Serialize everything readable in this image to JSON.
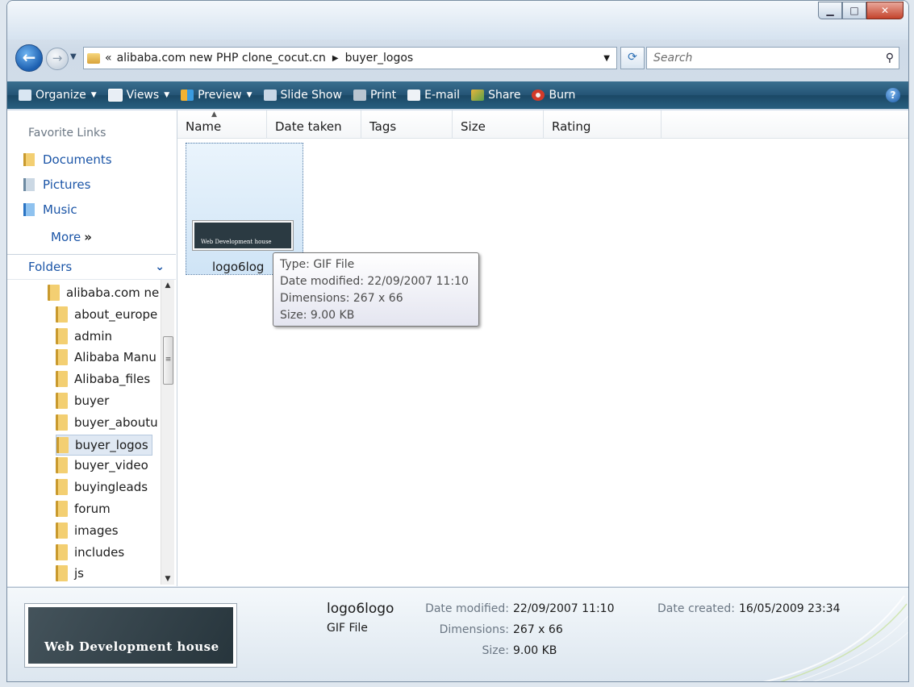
{
  "address": {
    "chevrons": "«",
    "crumbs": [
      "alibaba.com new PHP clone_cocut.cn",
      "buyer_logos"
    ]
  },
  "search": {
    "placeholder": "Search"
  },
  "toolbar": [
    {
      "label": "Organize",
      "icon": "organize-icon",
      "dropdown": true
    },
    {
      "label": "Views",
      "icon": "views-icon",
      "dropdown": true
    },
    {
      "label": "Preview",
      "icon": "preview-icon",
      "dropdown": true
    },
    {
      "label": "Slide Show",
      "icon": "slideshow-icon",
      "dropdown": false
    },
    {
      "label": "Print",
      "icon": "print-icon",
      "dropdown": false
    },
    {
      "label": "E-mail",
      "icon": "email-icon",
      "dropdown": false
    },
    {
      "label": "Share",
      "icon": "share-icon",
      "dropdown": false
    },
    {
      "label": "Burn",
      "icon": "burn-icon",
      "dropdown": false
    }
  ],
  "navpane": {
    "favorites_title": "Favorite Links",
    "favorites": [
      "Documents",
      "Pictures",
      "Music"
    ],
    "more": "More",
    "folders_title": "Folders",
    "tree": [
      {
        "label": "alibaba.com ne",
        "level": 0,
        "selected": false
      },
      {
        "label": "about_europe",
        "level": 1,
        "selected": false
      },
      {
        "label": "admin",
        "level": 1,
        "selected": false
      },
      {
        "label": "Alibaba Manu",
        "level": 1,
        "selected": false
      },
      {
        "label": "Alibaba_files",
        "level": 1,
        "selected": false
      },
      {
        "label": "buyer",
        "level": 1,
        "selected": false
      },
      {
        "label": "buyer_aboutu",
        "level": 1,
        "selected": false
      },
      {
        "label": "buyer_logos",
        "level": 1,
        "selected": true
      },
      {
        "label": "buyer_video",
        "level": 1,
        "selected": false
      },
      {
        "label": "buyingleads",
        "level": 1,
        "selected": false
      },
      {
        "label": "forum",
        "level": 1,
        "selected": false
      },
      {
        "label": "images",
        "level": 1,
        "selected": false
      },
      {
        "label": "includes",
        "level": 1,
        "selected": false
      },
      {
        "label": "js",
        "level": 1,
        "selected": false
      }
    ]
  },
  "columns": [
    "Name",
    "Date taken",
    "Tags",
    "Size",
    "Rating"
  ],
  "file": {
    "name": "logo6logo",
    "name_truncated": "logo6log",
    "thumb_text": "Web Development house"
  },
  "tooltip": {
    "type": "Type: GIF File",
    "modified": "Date modified: 22/09/2007 11:10",
    "dimensions": "Dimensions: 267 x 66",
    "size": "Size: 9.00 KB"
  },
  "details": {
    "filename": "logo6logo",
    "filetype": "GIF File",
    "date_modified_label": "Date modified:",
    "date_modified": "22/09/2007 11:10",
    "dimensions_label": "Dimensions:",
    "dimensions": "267 x 66",
    "size_label": "Size:",
    "size": "9.00 KB",
    "date_created_label": "Date created:",
    "date_created": "16/05/2009 23:34",
    "thumb_text": "Web Development house"
  },
  "colors": {
    "toolbar": "#245475",
    "link": "#1b55a7",
    "selection": "#cfe4f6"
  }
}
